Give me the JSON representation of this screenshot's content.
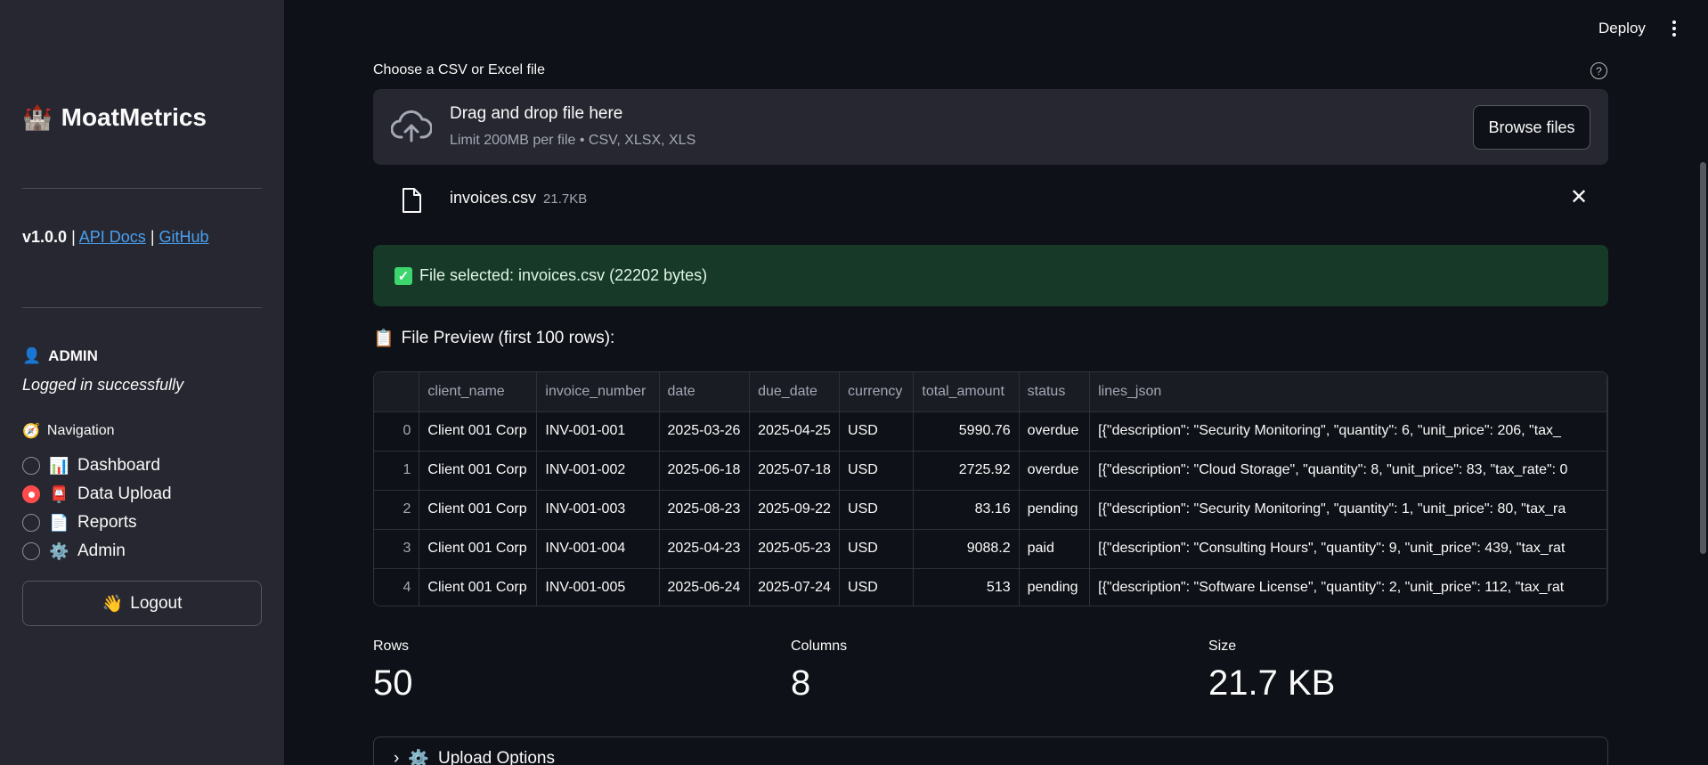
{
  "app": {
    "title": "MoatMetrics",
    "logo_icon": "castle-icon",
    "version": "v1.0.0",
    "sep": "|",
    "api_docs": "API Docs",
    "github": "GitHub"
  },
  "user": {
    "name": "ADMIN",
    "status": "Logged in successfully"
  },
  "nav": {
    "heading": "Navigation",
    "items": [
      {
        "label": "Dashboard",
        "icon": "chart-icon",
        "selected": false
      },
      {
        "label": "Data Upload",
        "icon": "mailbox-icon",
        "selected": true
      },
      {
        "label": "Reports",
        "icon": "document-icon",
        "selected": false
      },
      {
        "label": "Admin",
        "icon": "gear-icon",
        "selected": false
      }
    ],
    "logout": "Logout"
  },
  "header": {
    "deploy": "Deploy"
  },
  "upload": {
    "label": "Choose a CSV or Excel file",
    "drop_title": "Drag and drop file here",
    "limit": "Limit 200MB per file • CSV, XLSX, XLS",
    "browse": "Browse files",
    "file_name": "invoices.csv",
    "file_size": "21.7KB"
  },
  "success_msg": "File selected: invoices.csv (22202 bytes)",
  "preview_title": "File Preview (first 100 rows):",
  "table": {
    "columns": [
      "",
      "client_name",
      "invoice_number",
      "date",
      "due_date",
      "currency",
      "total_amount",
      "status",
      "lines_json"
    ],
    "rows": [
      [
        "0",
        "Client 001 Corp",
        "INV-001-001",
        "2025-03-26",
        "2025-04-25",
        "USD",
        "5990.76",
        "overdue",
        "[{\"description\": \"Security Monitoring\", \"quantity\": 6, \"unit_price\": 206, \"tax_"
      ],
      [
        "1",
        "Client 001 Corp",
        "INV-001-002",
        "2025-06-18",
        "2025-07-18",
        "USD",
        "2725.92",
        "overdue",
        "[{\"description\": \"Cloud Storage\", \"quantity\": 8, \"unit_price\": 83, \"tax_rate\": 0"
      ],
      [
        "2",
        "Client 001 Corp",
        "INV-001-003",
        "2025-08-23",
        "2025-09-22",
        "USD",
        "83.16",
        "pending",
        "[{\"description\": \"Security Monitoring\", \"quantity\": 1, \"unit_price\": 80, \"tax_ra"
      ],
      [
        "3",
        "Client 001 Corp",
        "INV-001-004",
        "2025-04-23",
        "2025-05-23",
        "USD",
        "9088.2",
        "paid",
        "[{\"description\": \"Consulting Hours\", \"quantity\": 9, \"unit_price\": 439, \"tax_rat"
      ],
      [
        "4",
        "Client 001 Corp",
        "INV-001-005",
        "2025-06-24",
        "2025-07-24",
        "USD",
        "513",
        "pending",
        "[{\"description\": \"Software License\", \"quantity\": 2, \"unit_price\": 112, \"tax_rat"
      ]
    ]
  },
  "metrics": [
    {
      "label": "Rows",
      "value": "50"
    },
    {
      "label": "Columns",
      "value": "8"
    },
    {
      "label": "Size",
      "value": "21.7 KB"
    }
  ],
  "expander": {
    "label": "Upload Options"
  },
  "colors": {
    "accent": "#ff4b4b",
    "success_bg": "#173928",
    "link": "#4aa0f0"
  }
}
